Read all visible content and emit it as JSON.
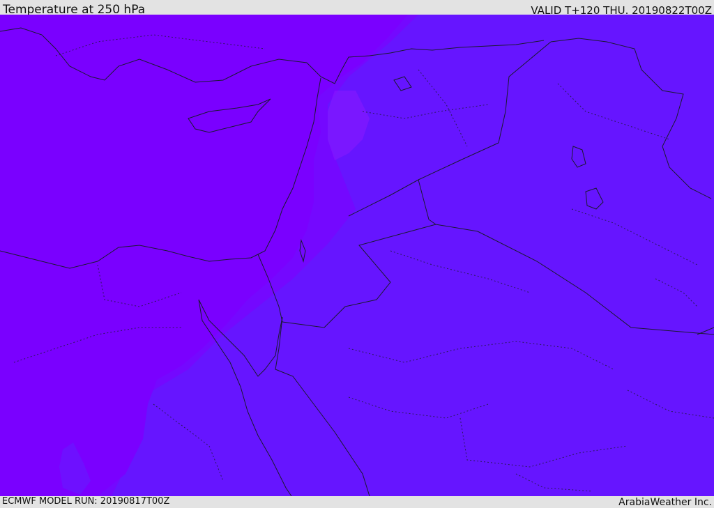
{
  "header": {
    "title": "Temperature at 250 hPa",
    "valid": "VALID T+120 THU. 20190822T00Z"
  },
  "footer": {
    "model_run": "ECMWF MODEL RUN: 20190817T00Z",
    "credit": "ArabiaWeather Inc."
  },
  "colors": {
    "frame": "#e3e3e3",
    "cold_field": "#7a00ff",
    "warmer_field": "#6615ff",
    "transition_band": "#7408ff",
    "warm_blob": "#8a1aff",
    "coastline": "#1a1a2e",
    "border": "#1a1a2e"
  }
}
